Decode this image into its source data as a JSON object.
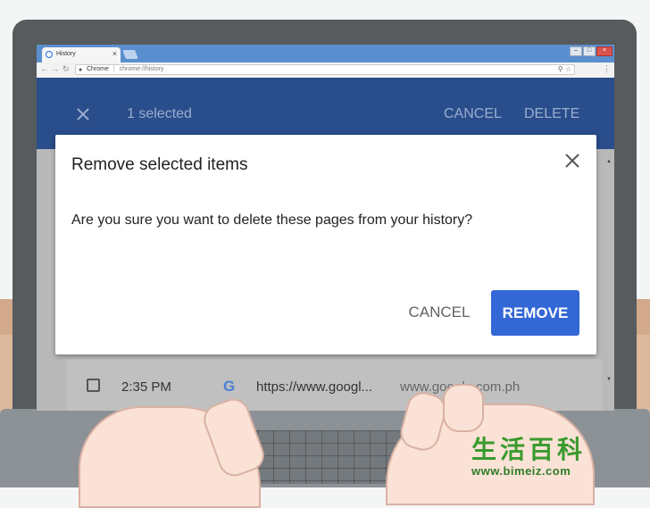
{
  "browser": {
    "tab_title": "History",
    "omnibox_chip": "Chrome",
    "omnibox_url": "chrome://history"
  },
  "history_header": {
    "selected_count": "1 selected",
    "cancel_label": "CANCEL",
    "delete_label": "DELETE"
  },
  "history_row": {
    "time": "2:35 PM",
    "favicon_letter": "G",
    "url": "https://www.googl...",
    "domain": "www.google.com.ph"
  },
  "dialog": {
    "title": "Remove selected items",
    "message": "Are you sure you want to delete these pages from your history?",
    "cancel_label": "CANCEL",
    "remove_label": "REMOVE"
  },
  "watermark": {
    "chars": [
      "生",
      "活",
      "百",
      "科"
    ],
    "url": "www.bimeiz.com"
  },
  "colors": {
    "header_blue": "#2a4d8b",
    "primary_button": "#3367d6",
    "tabstrip": "#5a8fcf"
  }
}
